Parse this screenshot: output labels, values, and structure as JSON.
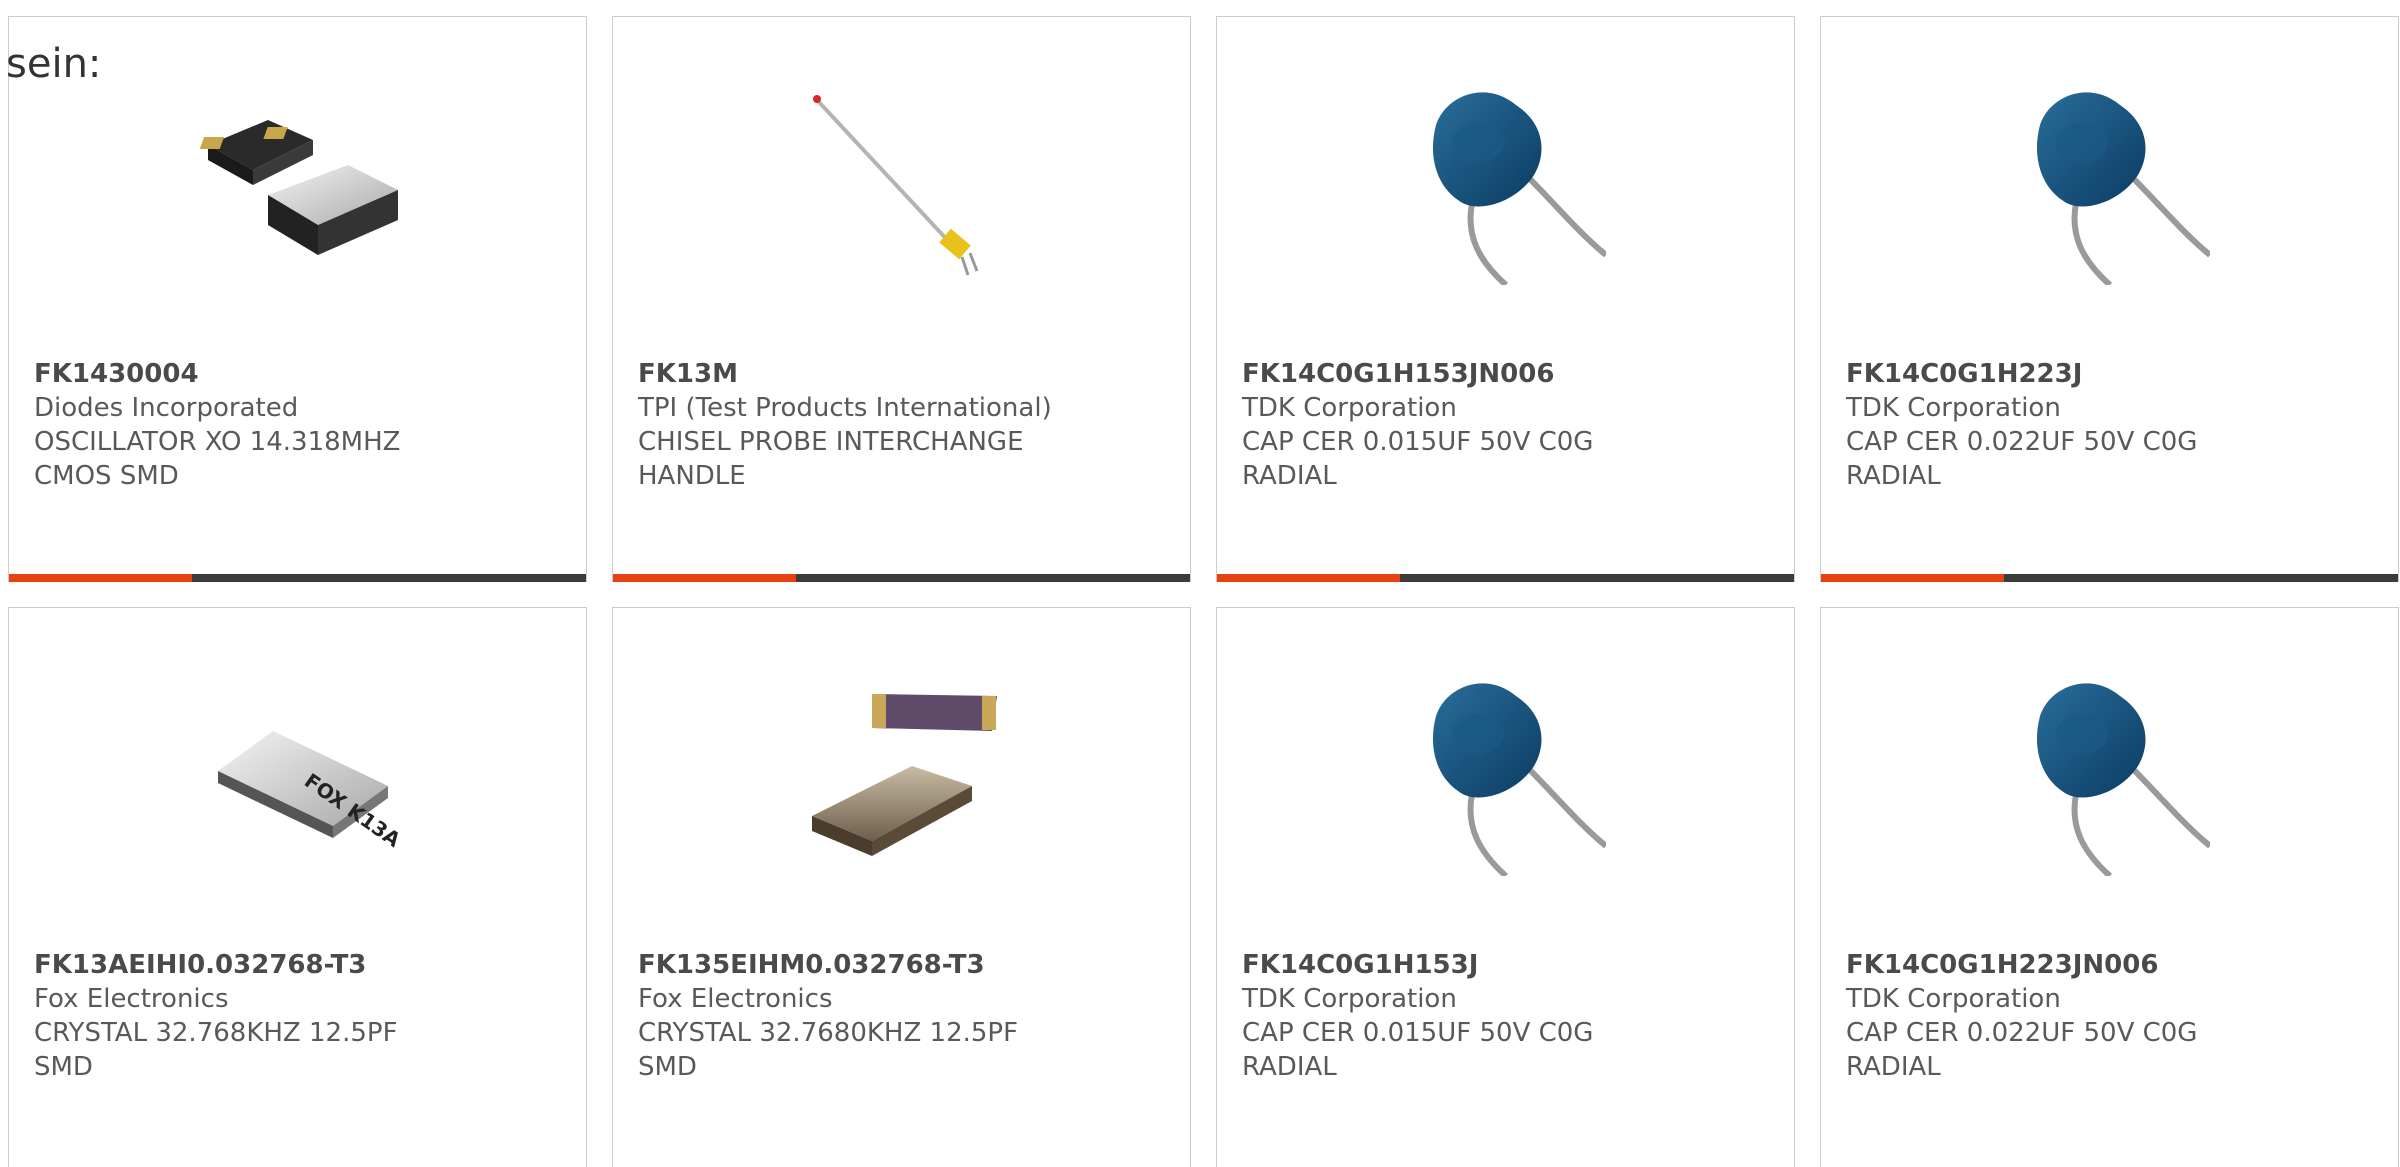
{
  "intro_text": "sein:",
  "colors": {
    "accent": "#e84111",
    "bar": "#3c3c3c",
    "border": "#cccccc",
    "text": "#595959"
  },
  "products": [
    {
      "part_number": "FK1430004",
      "manufacturer": "Diodes Incorporated",
      "description": "OSCILLATOR XO 14.318MHZ CMOS SMD",
      "image": "oscillator-smd"
    },
    {
      "part_number": "FK13M",
      "manufacturer": "TPI (Test Products International)",
      "description": "CHISEL PROBE INTERCHANGE HANDLE",
      "image": "probe"
    },
    {
      "part_number": "FK14C0G1H153JN006",
      "manufacturer": "TDK Corporation",
      "description": "CAP CER 0.015UF 50V C0G RADIAL",
      "image": "ceramic-capacitor"
    },
    {
      "part_number": "FK14C0G1H223J",
      "manufacturer": "TDK Corporation",
      "description": "CAP CER 0.022UF 50V C0G RADIAL",
      "image": "ceramic-capacitor"
    },
    {
      "part_number": "FK13AEIHI0.032768-T3",
      "manufacturer": "Fox Electronics",
      "description": "CRYSTAL 32.768KHZ 12.5PF SMD",
      "image": "crystal-fox",
      "chip_label": "FOX K13A"
    },
    {
      "part_number": "FK135EIHM0.032768-T3",
      "manufacturer": "Fox Electronics",
      "description": "CRYSTAL 32.7680KHZ 12.5PF SMD",
      "image": "crystal-smd"
    },
    {
      "part_number": "FK14C0G1H153J",
      "manufacturer": "TDK Corporation",
      "description": "CAP CER 0.015UF 50V C0G RADIAL",
      "image": "ceramic-capacitor"
    },
    {
      "part_number": "FK14C0G1H223JN006",
      "manufacturer": "TDK Corporation",
      "description": "CAP CER 0.022UF 50V C0G RADIAL",
      "image": "ceramic-capacitor"
    }
  ]
}
